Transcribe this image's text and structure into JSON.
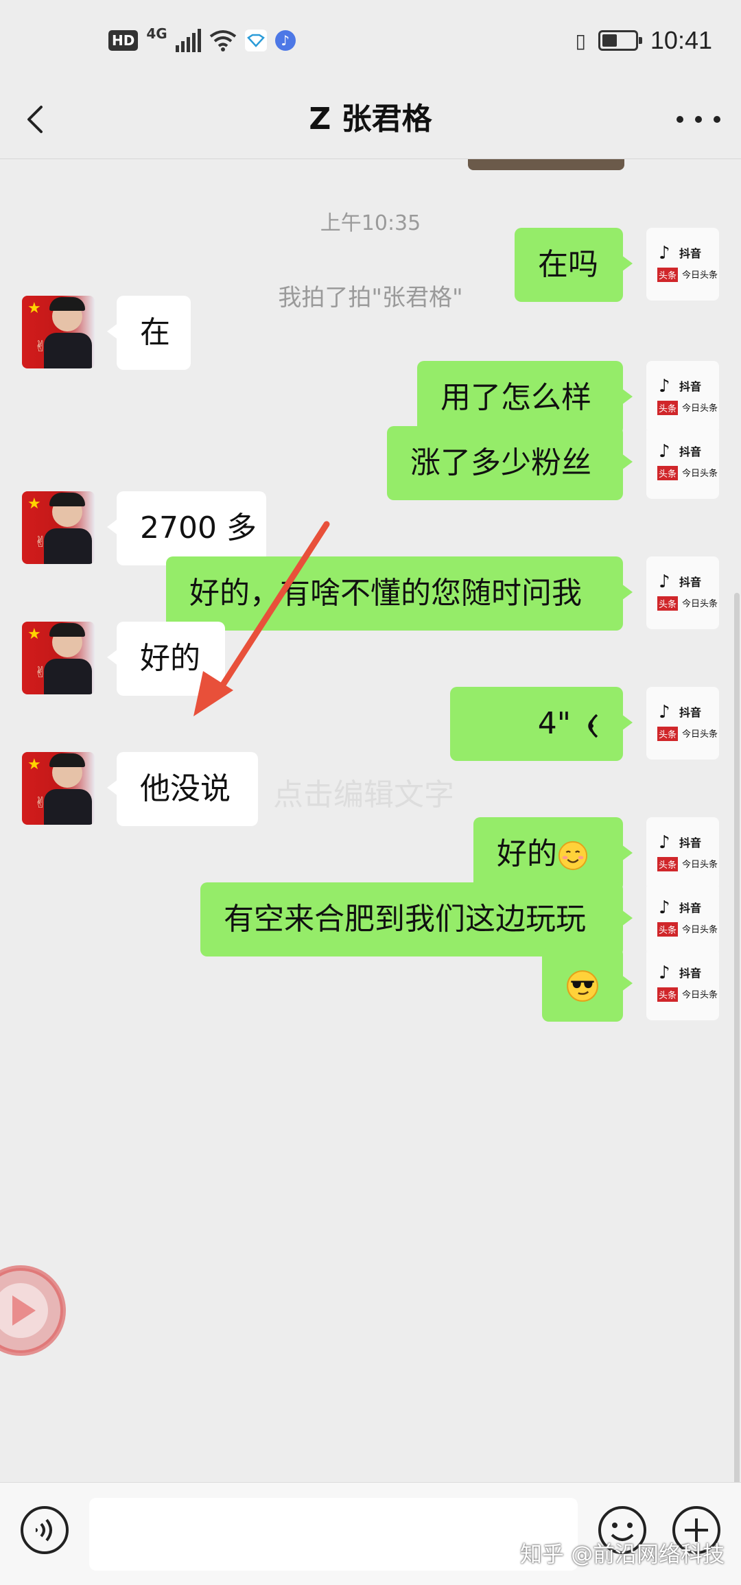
{
  "status_bar": {
    "hd": "HD",
    "network": "4G",
    "time": "10:41",
    "battery_level": 0.4,
    "icons": [
      "signal-icon",
      "wifi-icon",
      "app-icon",
      "music-icon",
      "vibrate-icon",
      "battery-icon"
    ]
  },
  "header": {
    "title": "Z 张君格",
    "back_icon": "chevron-left-icon",
    "more_icon": "more-dots-icon"
  },
  "chat": {
    "timestamp": "上午10:35",
    "system_message": "我拍了拍\"张君格\"",
    "messages": [
      {
        "side": "out",
        "text": "在吗"
      },
      {
        "side": "in",
        "text": "在"
      },
      {
        "side": "out",
        "text": "用了怎么样"
      },
      {
        "side": "out",
        "text": "涨了多少粉丝"
      },
      {
        "side": "in",
        "text": "2700 多"
      },
      {
        "side": "out",
        "text": "好的，有啥不懂的您随时问我"
      },
      {
        "side": "in",
        "text": "好的"
      },
      {
        "side": "out",
        "type": "voice",
        "duration": "4\""
      },
      {
        "side": "in",
        "text": "他没说"
      },
      {
        "side": "out",
        "text": "好的",
        "emoji": "smile"
      },
      {
        "side": "out",
        "text": "有空来合肥到我们这边玩玩"
      },
      {
        "side": "out",
        "type": "emoji",
        "emoji": "sunglasses"
      }
    ],
    "my_avatar": {
      "line1": "抖音",
      "line2": "头条",
      "line3": "今日头条"
    },
    "watermark_center": "点击编辑文字"
  },
  "input_bar": {
    "voice_icon": "voice-input-icon",
    "emoji_icon": "emoji-icon",
    "plus_icon": "plus-icon"
  },
  "watermark_bottom": "知乎 @前沿网络科技",
  "colors": {
    "background": "#ededed",
    "outgoing_bubble": "#95ec69",
    "incoming_bubble": "#ffffff",
    "annotation_arrow": "#e8503a"
  }
}
